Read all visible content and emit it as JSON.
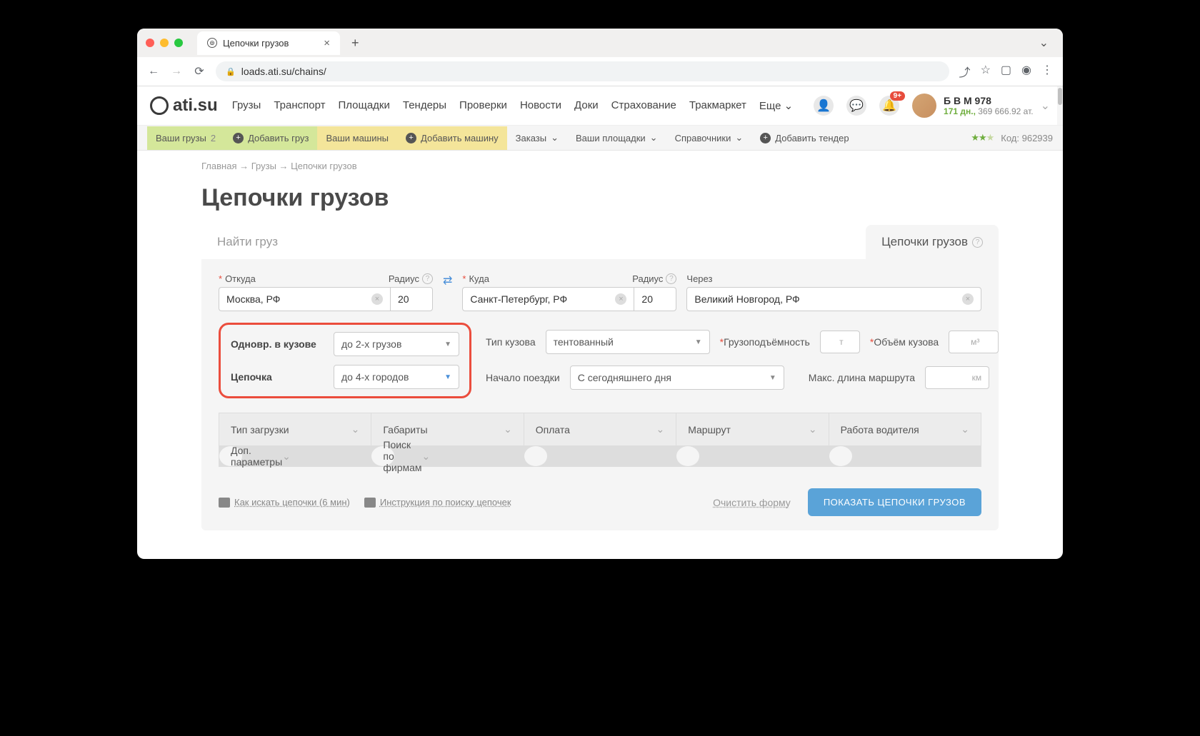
{
  "browser": {
    "tab_title": "Цепочки грузов",
    "url": "loads.ati.su/chains/"
  },
  "header": {
    "logo": "ati.su",
    "nav": [
      "Грузы",
      "Транспорт",
      "Площадки",
      "Тендеры",
      "Проверки",
      "Новости",
      "Доки",
      "Страхование",
      "Тракмаркет",
      "Еще"
    ],
    "badge": "9+",
    "user": {
      "name": "Б В М 978",
      "days": "171 дн.,",
      "balance": "369 666.92 ат."
    }
  },
  "subnav": {
    "yourCargo": "Ваши грузы",
    "cargoCount": "2",
    "addCargo": "Добавить груз",
    "yourTrucks": "Ваши машины",
    "addTruck": "Добавить машину",
    "orders": "Заказы",
    "platforms": "Ваши площадки",
    "refs": "Справочники",
    "addTender": "Добавить тендер",
    "code": "Код: 962939"
  },
  "breadcrumbs": {
    "home": "Главная",
    "cargo": "Грузы",
    "current": "Цепочки грузов"
  },
  "page": {
    "title": "Цепочки грузов",
    "tab_find": "Найти груз",
    "tab_chains": "Цепочки грузов"
  },
  "form": {
    "from_label": "Откуда",
    "radius_label": "Радиус",
    "from_value": "Москва, РФ",
    "from_radius": "20",
    "to_label": "Куда",
    "to_value": "Санкт-Петербург, РФ",
    "to_radius": "20",
    "via_label": "Через",
    "via_value": "Великий Новгород, РФ",
    "simul_label": "Одновр. в кузове",
    "simul_value": "до 2-х грузов",
    "chain_label": "Цепочка",
    "chain_value": "до 4-х городов",
    "body_label": "Тип кузова",
    "body_value": "тентованный",
    "cap_label": "Грузоподъёмность",
    "cap_unit": "т",
    "vol_label": "Объём кузова",
    "vol_unit": "м³",
    "start_label": "Начало поездки",
    "start_value": "С сегодняшнего дня",
    "maxlen_label": "Макс. длина маршрута",
    "maxlen_unit": "км",
    "filters": [
      "Тип загрузки",
      "Габариты",
      "Оплата",
      "Маршрут",
      "Работа водителя",
      "Доп. параметры",
      "Поиск по фирмам"
    ],
    "help_video": "Как искать цепочки (6 мин)",
    "help_doc": "Инструкция по поиску цепочек",
    "clear": "Очистить форму",
    "submit": "ПОКАЗАТЬ ЦЕПОЧКИ ГРУЗОВ"
  }
}
